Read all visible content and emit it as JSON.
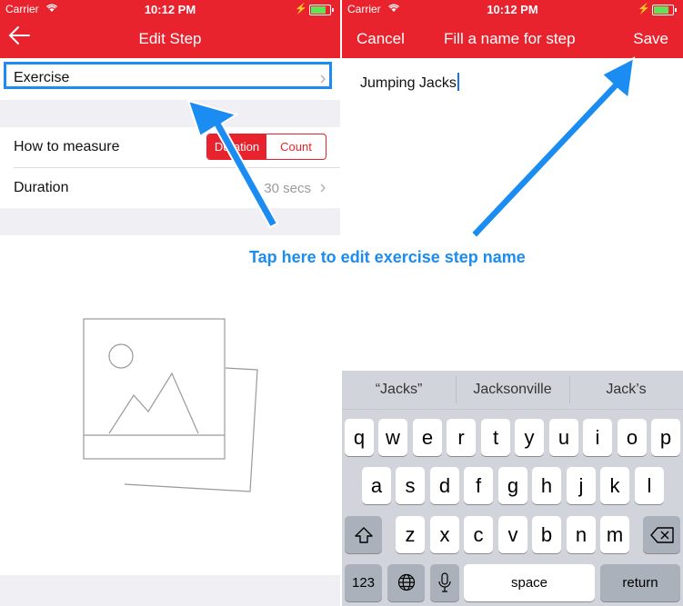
{
  "left": {
    "status": {
      "carrier": "Carrier",
      "time": "10:12 PM"
    },
    "nav": {
      "title": "Edit Step"
    },
    "exercise": {
      "label": "Exercise"
    },
    "measure": {
      "label": "How to measure",
      "options": [
        "Duration",
        "Count"
      ],
      "selected": "Duration"
    },
    "duration": {
      "label": "Duration",
      "value": "30 secs"
    }
  },
  "right": {
    "status": {
      "carrier": "Carrier",
      "time": "10:12 PM"
    },
    "nav": {
      "cancel": "Cancel",
      "title": "Fill a name for step",
      "save": "Save"
    },
    "input": {
      "value": "Jumping Jacks"
    },
    "suggestions": [
      "“Jacks”",
      "Jacksonville",
      "Jack’s"
    ],
    "keyboard": {
      "row1": [
        "q",
        "w",
        "e",
        "r",
        "t",
        "y",
        "u",
        "i",
        "o",
        "p"
      ],
      "row2": [
        "a",
        "s",
        "d",
        "f",
        "g",
        "h",
        "j",
        "k",
        "l"
      ],
      "row3": [
        "z",
        "x",
        "c",
        "v",
        "b",
        "n",
        "m"
      ],
      "numbers": "123",
      "space": "space",
      "return": "return"
    }
  },
  "annotation": {
    "caption": "Tap here to edit exercise step name"
  },
  "colors": {
    "accent": "#e8232d",
    "annotation": "#1a8cf2"
  }
}
